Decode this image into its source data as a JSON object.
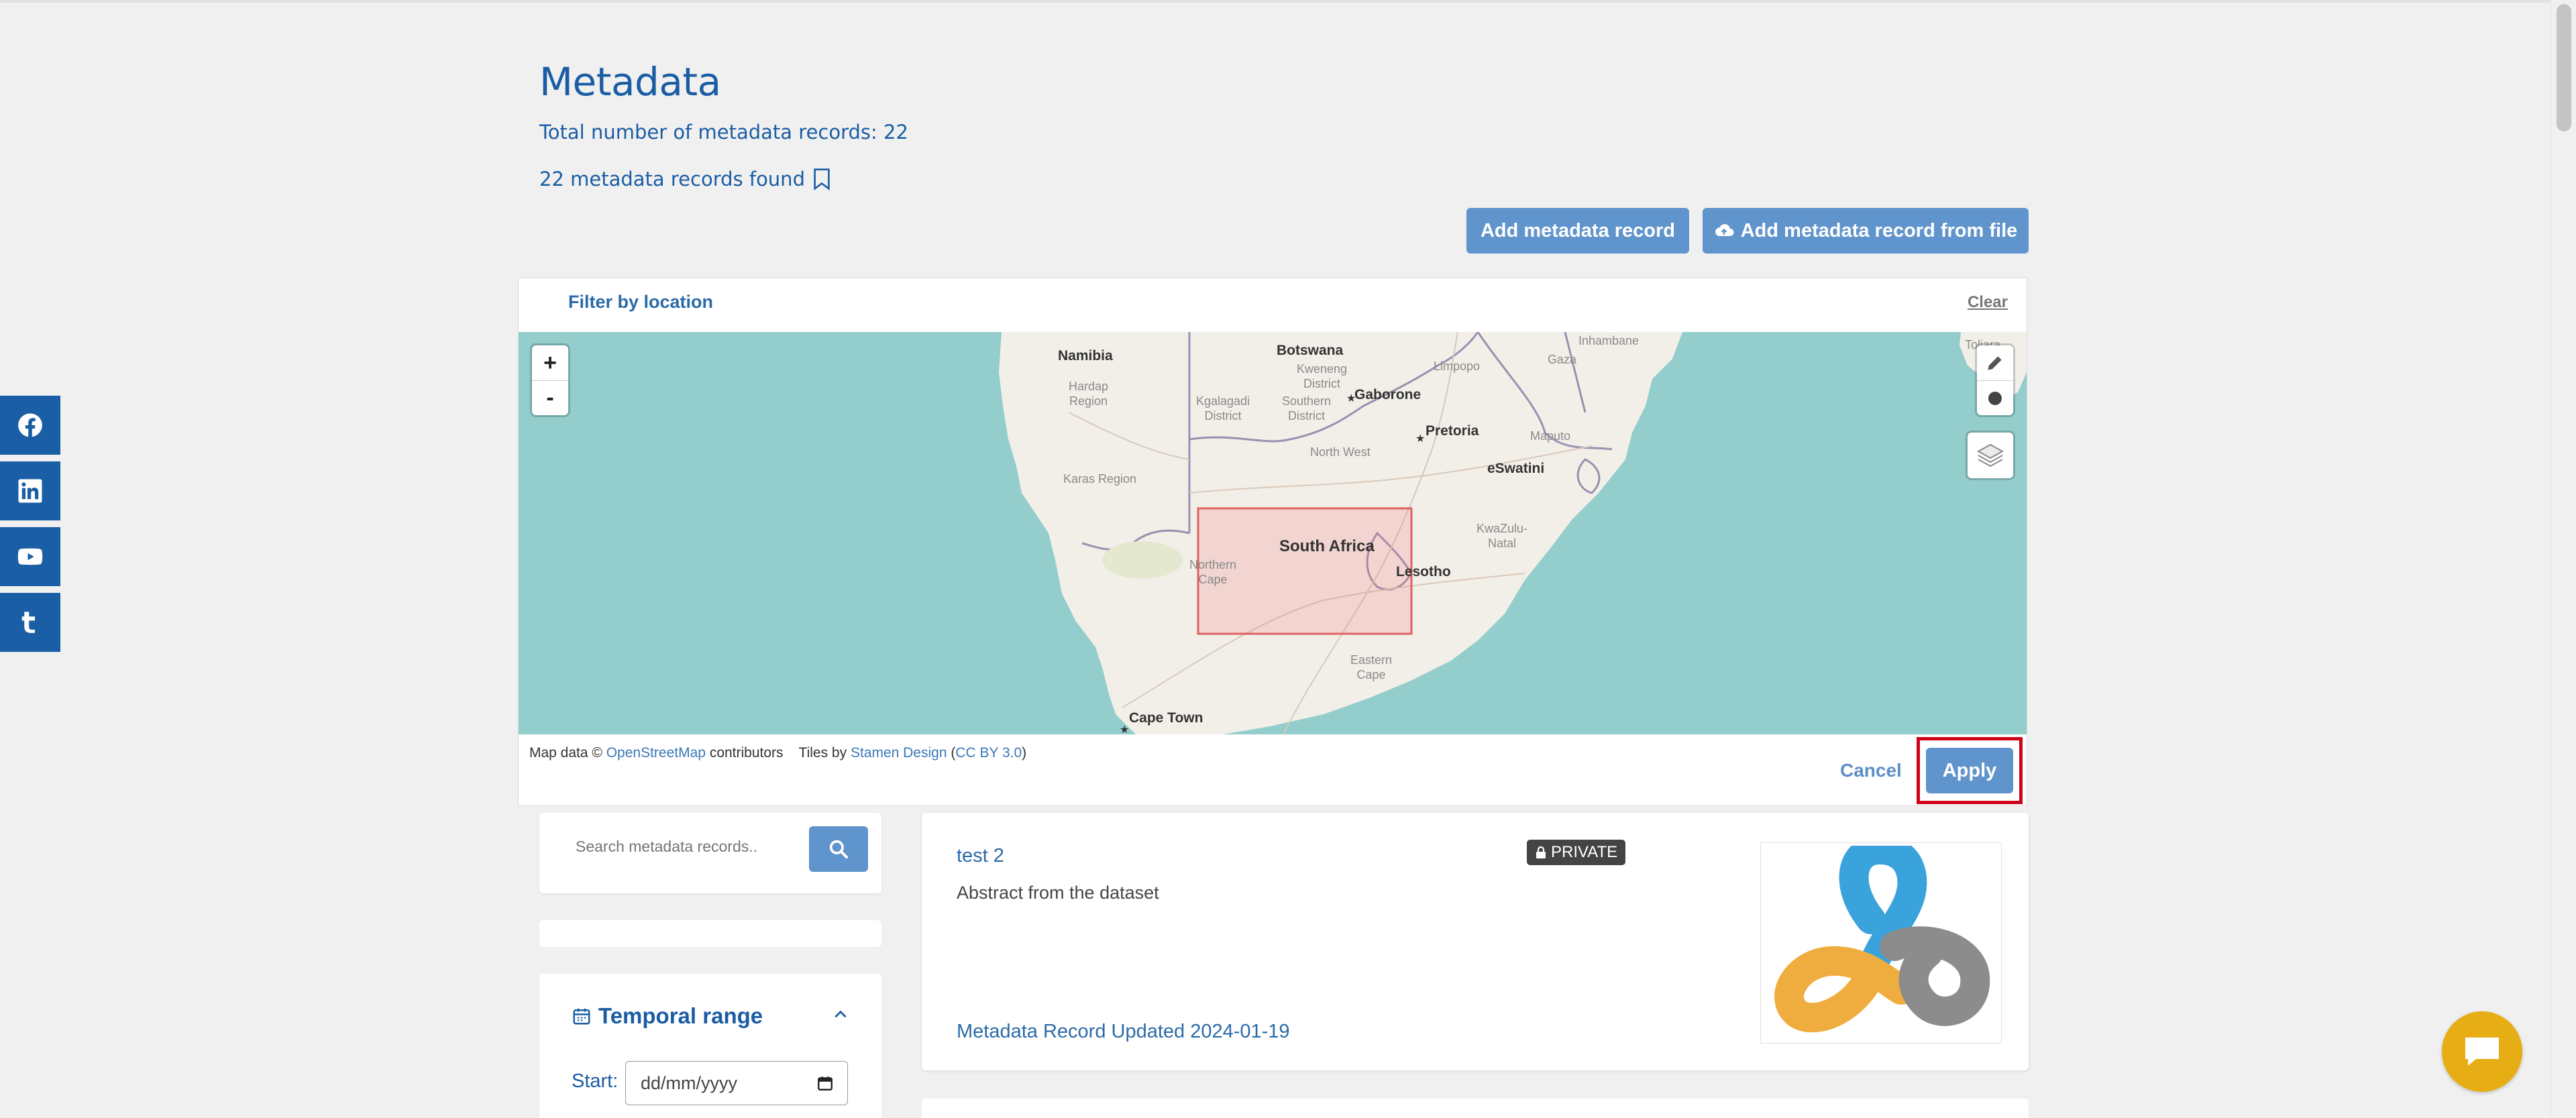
{
  "header": {
    "title": "Metadata",
    "total_records": "Total number of metadata records: 22",
    "records_found": "22 metadata records found"
  },
  "actions": {
    "add_record": "Add metadata record",
    "add_record_from_file": "Add metadata record from file"
  },
  "location_filter": {
    "title": "Filter by location",
    "clear": "Clear",
    "zoom_in": "+",
    "zoom_out": "-",
    "cancel": "Cancel",
    "apply": "Apply",
    "attribution": {
      "prefix": "Map data ©",
      "osm": "OpenStreetMap",
      "contributors": "contributors",
      "tiles_by": "Tiles by",
      "stamen": "Stamen Design",
      "license": "CC BY 3.0"
    },
    "map_labels": {
      "namibia": "Namibia",
      "hardap": "Hardap\nRegion",
      "karas": "Karas Region",
      "botswana": "Botswana",
      "kweneng": "Kweneng\nDistrict",
      "kgalagadi": "Kgalagadi\nDistrict",
      "southern": "Southern\nDistrict",
      "gaborone": "Gaborone",
      "limpopo": "Limpopo",
      "gaza": "Gaza",
      "inhambane": "Inhambane",
      "pretoria": "Pretoria",
      "north_west": "North West",
      "maputo": "Maputo",
      "eswatini": "eSwatini",
      "south_africa": "South Africa",
      "northern_cape": "Northern\nCape",
      "kwazulu": "KwaZulu-\nNatal",
      "lesotho": "Lesotho",
      "eastern_cape": "Eastern\nCape",
      "cape_town": "Cape Town",
      "toliara": "Toliara"
    }
  },
  "search": {
    "placeholder": "Search metadata records.."
  },
  "temporal": {
    "title": "Temporal range",
    "start_label": "Start:",
    "start_placeholder": "dd/mm/yyyy"
  },
  "results": [
    {
      "title": "test 2",
      "badge": "PRIVATE",
      "abstract": "Abstract from the dataset",
      "updated": "Metadata Record Updated 2024-01-19"
    }
  ],
  "colors": {
    "brand_blue": "#1b5da4",
    "button_blue": "#6094cc",
    "water": "#93cdcc",
    "highlight_red": "#d0021b",
    "chat_yellow": "#e6ad14"
  }
}
